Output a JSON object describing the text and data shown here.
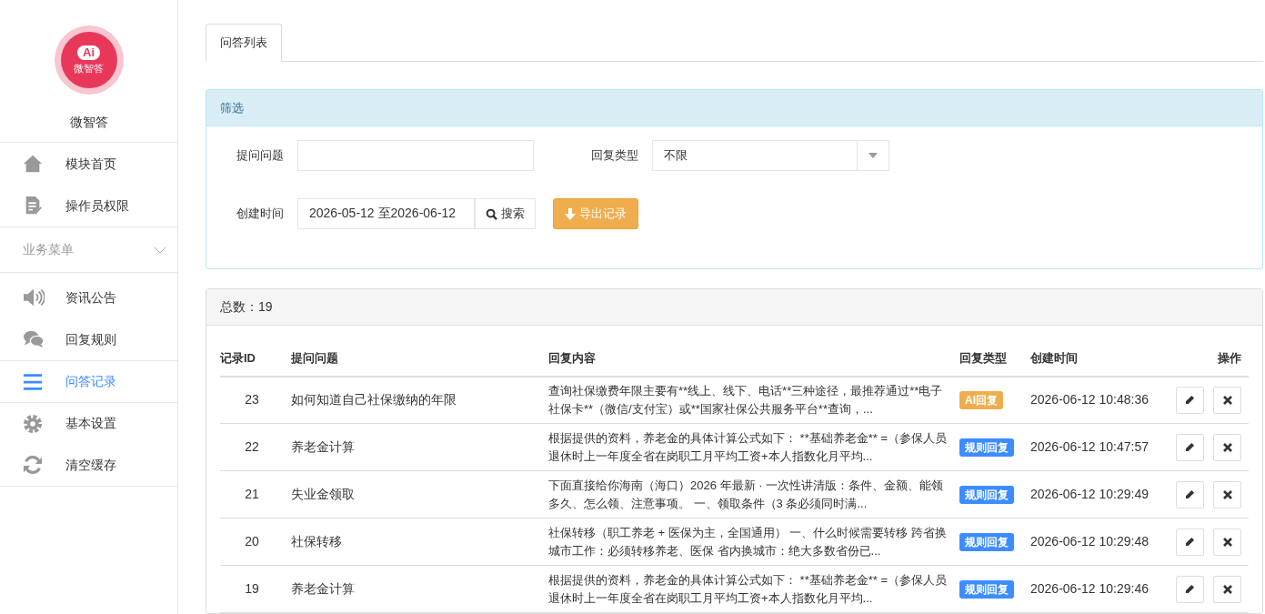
{
  "app": {
    "logo_text": "Ai",
    "logo_caption": "微智答",
    "name": "微智答"
  },
  "sidebar": {
    "items": [
      {
        "label": "模块首页",
        "selected": false
      },
      {
        "label": "操作员权限",
        "selected": false
      }
    ],
    "section": {
      "label": "业务菜单",
      "expanded": true,
      "items": [
        {
          "label": "资讯公告",
          "selected": false
        },
        {
          "label": "回复规则",
          "selected": false
        },
        {
          "label": "问答记录",
          "selected": true
        },
        {
          "label": "基本设置",
          "selected": false
        },
        {
          "label": "清空缓存",
          "selected": false
        }
      ]
    }
  },
  "tabs": [
    {
      "label": "问答列表",
      "selected": true
    }
  ],
  "filter": {
    "title": "筛选",
    "question_label": "提问问题",
    "type_label": "回复类型",
    "type_value": "不限",
    "time_label": "创建时间",
    "time_value": "2026-05-12 至2026-06-12",
    "search_button": "搜索",
    "export_button": "导出记录"
  },
  "table": {
    "total": "总数：19",
    "columns": [
      "记录ID",
      "提问问题",
      "回复内容",
      "回复类型",
      "创建时间",
      "操作"
    ],
    "rows": [
      {
        "id": "23",
        "question": "如何知道自己社保缴纳的年限",
        "content": "查询社保缴费年限主要有**线上、线下、电话**三种途径，最推荐通过**电子社保卡**（微信/支付宝）或**国家社保公共服务平台**查询，...",
        "type": {
          "label": "AI回复",
          "kind": "ai"
        },
        "time": "2026-06-12 10:48:36"
      },
      {
        "id": "22",
        "question": "养老金计算",
        "content": "根据提供的资料，养老金的具体计算公式如下： **基础养老金** =（参保人员退休时上一年度全省在岗职工月平均工资+本人指数化月平均...",
        "type": {
          "label": "规则回复",
          "kind": "rule"
        },
        "time": "2026-06-12 10:47:57"
      },
      {
        "id": "21",
        "question": "失业金领取",
        "content": "下面直接给你海南（海口）2026 年最新 · 一次性讲清版：条件、金额、能领多久、怎么领、注意事项。 一、领取条件（3 条必须同时满...",
        "type": {
          "label": "规则回复",
          "kind": "rule"
        },
        "time": "2026-06-12 10:29:49"
      },
      {
        "id": "20",
        "question": "社保转移",
        "content": "社保转移（职工养老 + 医保为主，全国通用） 一、什么时候需要转移 跨省换城市工作：必须转移养老、医保 省内换城市：绝大多数省份已...",
        "type": {
          "label": "规则回复",
          "kind": "rule"
        },
        "time": "2026-06-12 10:29:48"
      },
      {
        "id": "19",
        "question": "养老金计算",
        "content": "根据提供的资料，养老金的具体计算公式如下： **基础养老金** =（参保人员退休时上一年度全省在岗职工月平均工资+本人指数化月平均...",
        "type": {
          "label": "规则回复",
          "kind": "rule"
        },
        "time": "2026-06-12 10:29:46"
      }
    ]
  }
}
